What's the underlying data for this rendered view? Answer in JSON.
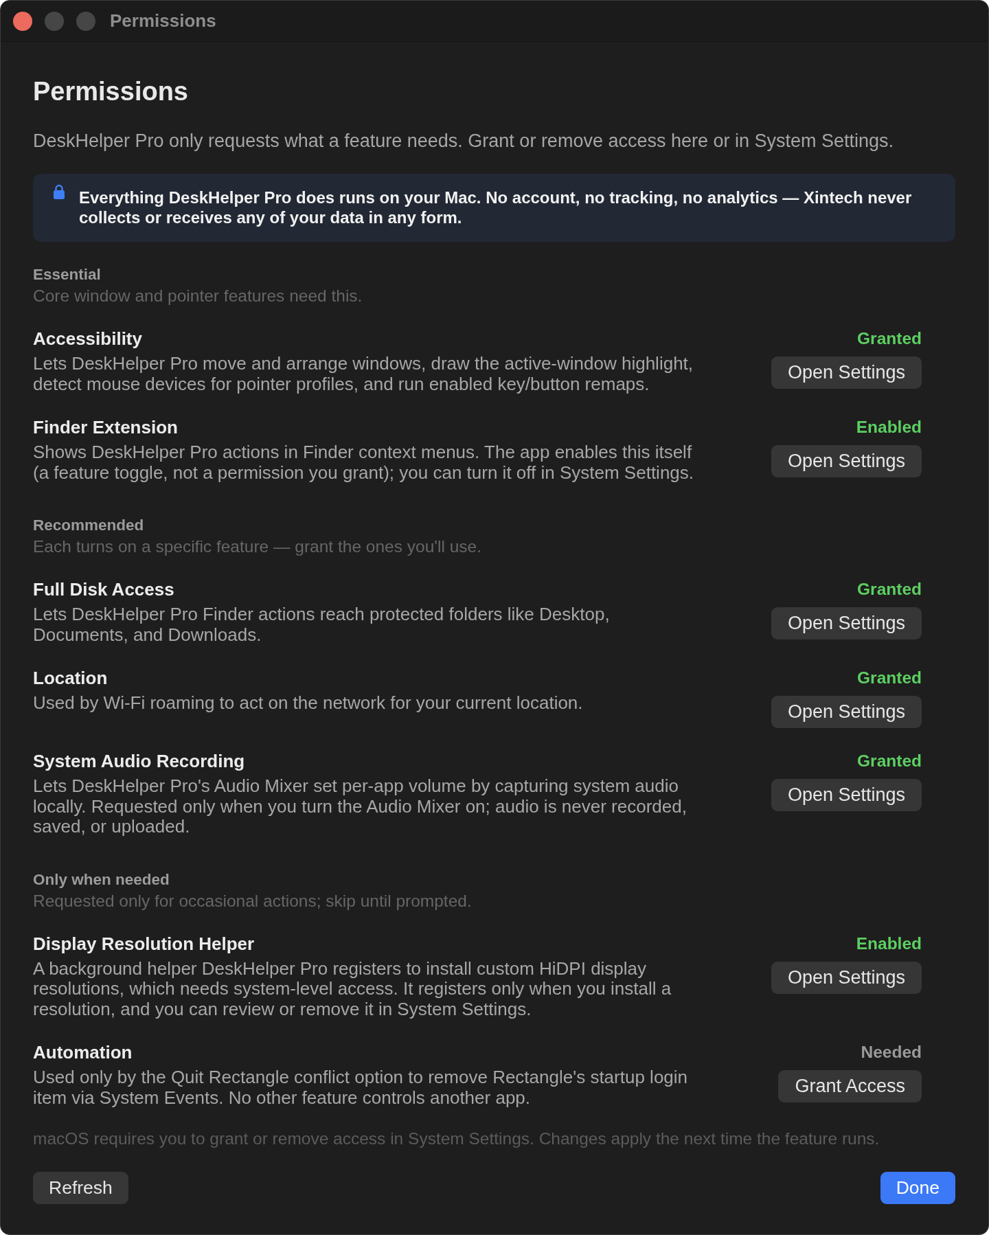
{
  "window": {
    "title": "Permissions",
    "controls": [
      {
        "kind": "close",
        "disabled": false
      },
      {
        "kind": "minimize",
        "disabled": true
      },
      {
        "kind": "zoom",
        "disabled": true
      }
    ]
  },
  "header": {
    "title": "Permissions",
    "subtitle": "DeskHelper Pro only requests what a feature needs. Grant or remove access here or in System Settings."
  },
  "privacy_note": "Everything DeskHelper Pro does runs on your Mac. No account, no tracking, no analytics — Xintech never collects or receives any of your data in any form.",
  "sections": [
    {
      "title": "Essential",
      "description": "Core window and pointer features need this.",
      "items": [
        {
          "name": "Accessibility",
          "description": "Lets DeskHelper Pro move and arrange windows, draw the active-window highlight, detect mouse devices for pointer profiles, and run enabled key/button remaps.",
          "status": "Granted",
          "granted": true,
          "action": "Open Settings"
        },
        {
          "name": "Finder Extension",
          "description": "Shows DeskHelper Pro actions in Finder context menus. The app enables this itself (a feature toggle, not a permission you grant); you can turn it off in System Settings.",
          "status": "Enabled",
          "granted": true,
          "action": "Open Settings"
        }
      ]
    },
    {
      "title": "Recommended",
      "description": "Each turns on a specific feature — grant the ones you'll use.",
      "items": [
        {
          "name": "Full Disk Access",
          "description": "Lets DeskHelper Pro Finder actions reach protected folders like Desktop, Documents, and Downloads.",
          "status": "Granted",
          "granted": true,
          "action": "Open Settings"
        },
        {
          "name": "Location",
          "description": "Used by Wi-Fi roaming to act on the network for your current location.",
          "status": "Granted",
          "granted": true,
          "action": "Open Settings"
        },
        {
          "name": "System Audio Recording",
          "description": "Lets DeskHelper Pro's Audio Mixer set per-app volume by capturing system audio locally. Requested only when you turn the Audio Mixer on; audio is never recorded, saved, or uploaded.",
          "status": "Granted",
          "granted": true,
          "action": "Open Settings"
        }
      ]
    },
    {
      "title": "Only when needed",
      "description": "Requested only for occasional actions; skip until prompted.",
      "items": [
        {
          "name": "Display Resolution Helper",
          "description": "A background helper DeskHelper Pro registers to install custom HiDPI display resolutions, which needs system-level access. It registers only when you install a resolution, and you can review or remove it in System Settings.",
          "status": "Enabled",
          "granted": true,
          "action": "Open Settings"
        },
        {
          "name": "Automation",
          "description": "Used only by the Quit Rectangle conflict option to remove Rectangle's startup login item via System Events. No other feature controls another app.",
          "status": "Needed",
          "granted": false,
          "action": "Grant Access"
        }
      ]
    }
  ],
  "footer": {
    "note": "macOS requires you to grant or remove access in System Settings. Changes apply the next time the feature runs.",
    "refresh_button": "Refresh",
    "done_button": "Done"
  }
}
